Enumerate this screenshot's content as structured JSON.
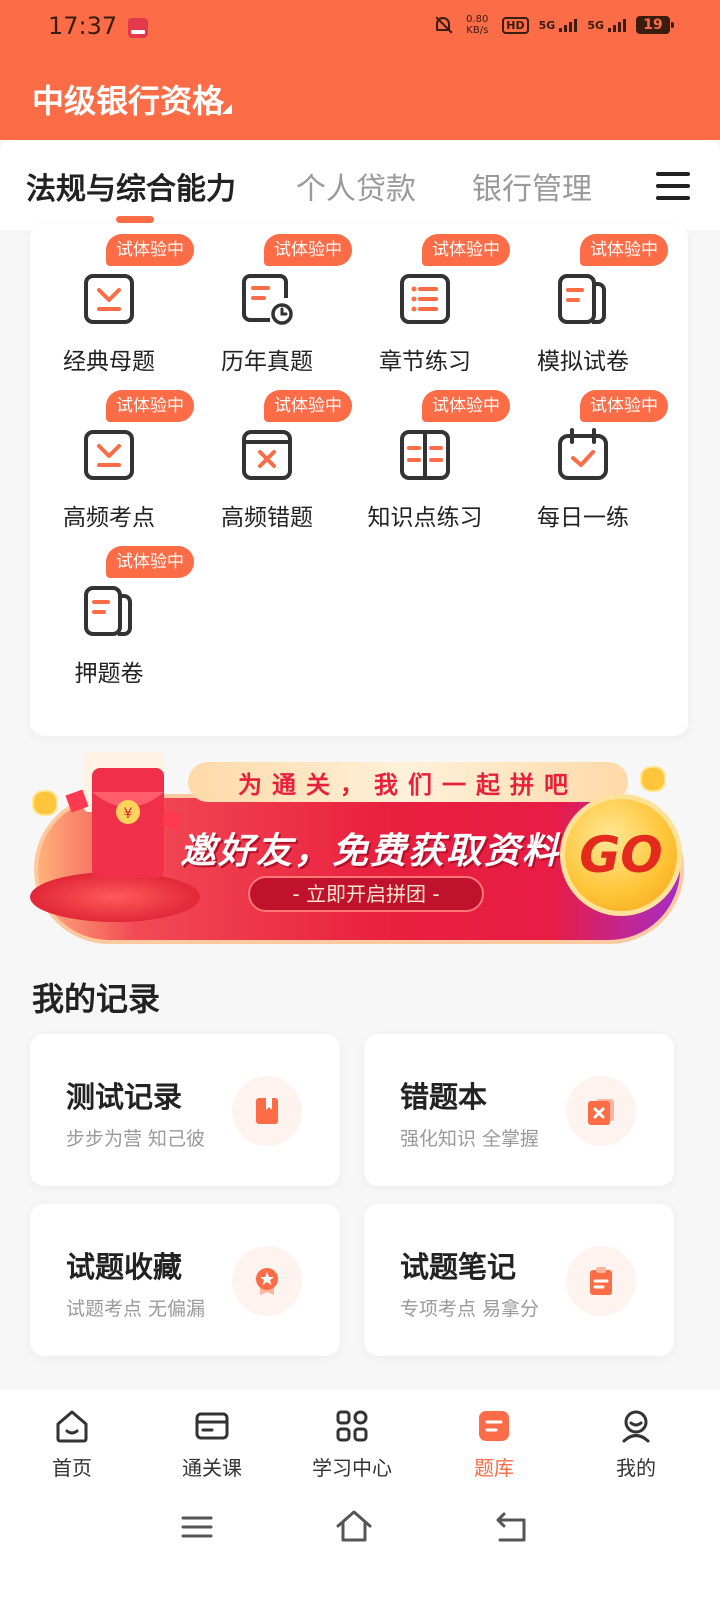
{
  "status_bar": {
    "time": "17:37",
    "net_speed_value": "0.80",
    "net_speed_unit": "KB/s",
    "hd": "HD",
    "signal_1": "5G",
    "signal_2": "5G",
    "battery": "19"
  },
  "header": {
    "title": "中级银行资格"
  },
  "tabs": [
    {
      "label": "法规与综合能力",
      "active": true
    },
    {
      "label": "个人贷款",
      "active": false
    },
    {
      "label": "银行管理",
      "active": false
    }
  ],
  "grid": {
    "badge": "试体验中",
    "items": [
      {
        "label": "经典母题",
        "icon": "classic-questions-icon"
      },
      {
        "label": "历年真题",
        "icon": "past-exams-icon"
      },
      {
        "label": "章节练习",
        "icon": "chapter-practice-icon"
      },
      {
        "label": "模拟试卷",
        "icon": "mock-paper-icon"
      },
      {
        "label": "高频考点",
        "icon": "frequent-points-icon"
      },
      {
        "label": "高频错题",
        "icon": "frequent-mistakes-icon"
      },
      {
        "label": "知识点练习",
        "icon": "knowledge-practice-icon"
      },
      {
        "label": "每日一练",
        "icon": "daily-practice-icon"
      },
      {
        "label": "押题卷",
        "icon": "predicted-paper-icon"
      }
    ]
  },
  "banner": {
    "top_text": "为通关，我们一起拼吧",
    "main_text": "邀好友，免费获取资料",
    "button_text": "- 立即开启拼团 -",
    "go_text": "GO"
  },
  "records": {
    "section_title": "我的记录",
    "cards": [
      {
        "title": "测试记录",
        "subtitle": "步步为营 知己彼",
        "icon": "bookmark-icon"
      },
      {
        "title": "错题本",
        "subtitle": "强化知识 全掌握",
        "icon": "wrong-book-icon"
      },
      {
        "title": "试题收藏",
        "subtitle": "试题考点 无偏漏",
        "icon": "favorite-star-icon"
      },
      {
        "title": "试题笔记",
        "subtitle": "专项考点 易拿分",
        "icon": "notes-clipboard-icon"
      }
    ]
  },
  "bottom_nav": [
    {
      "label": "首页",
      "icon": "home-icon",
      "active": false
    },
    {
      "label": "通关课",
      "icon": "course-card-icon",
      "active": false
    },
    {
      "label": "学习中心",
      "icon": "grid-icon",
      "active": false
    },
    {
      "label": "题库",
      "icon": "question-bank-icon",
      "active": true
    },
    {
      "label": "我的",
      "icon": "profile-icon",
      "active": false
    }
  ],
  "colors": {
    "accent": "#fb6c47",
    "text": "#222222",
    "muted": "#9a9a9a"
  }
}
